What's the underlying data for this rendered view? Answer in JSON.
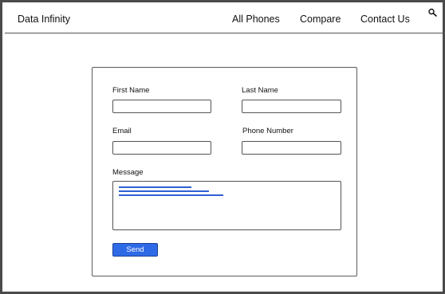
{
  "header": {
    "brand": "Data Infinity",
    "nav": {
      "all_phones": "All Phones",
      "compare": "Compare",
      "contact_us": "Contact Us"
    },
    "search_icon": "search-icon"
  },
  "form": {
    "first_name_label": "First Name",
    "last_name_label": "Last Name",
    "email_label": "Email",
    "phone_label": "Phone Number",
    "message_label": "Message",
    "send_label": "Send",
    "first_name_value": "",
    "last_name_value": "",
    "email_value": "",
    "phone_value": ""
  },
  "colors": {
    "accent": "#2f6ae6",
    "text_placeholder_lines": "#2f5fd3"
  }
}
